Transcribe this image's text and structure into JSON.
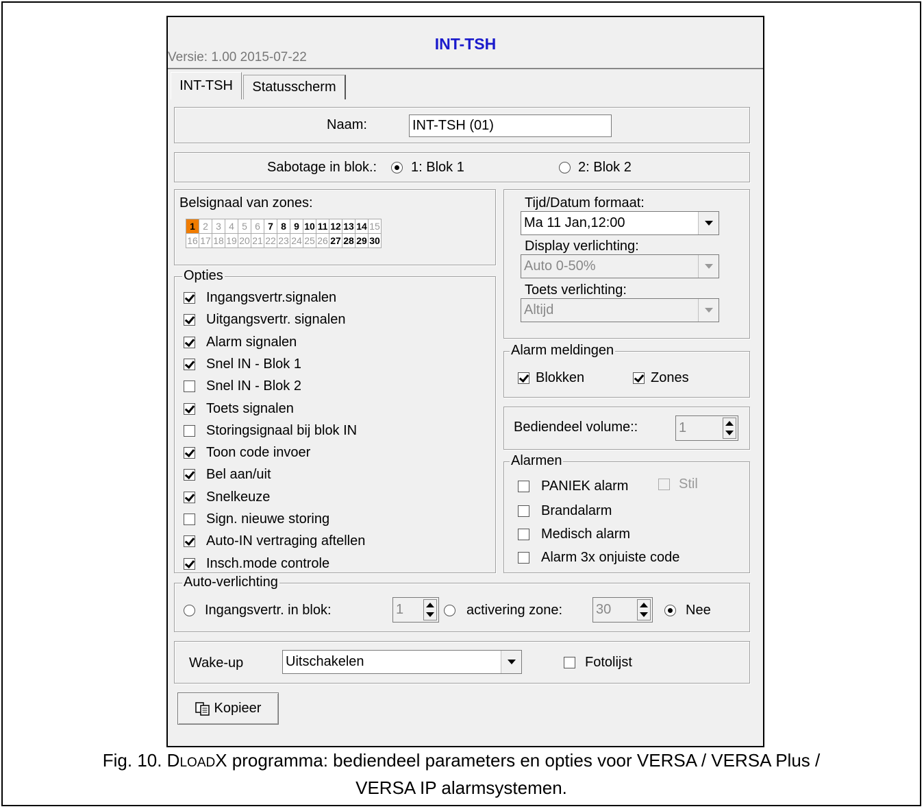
{
  "header": {
    "title": "INT-TSH",
    "version": "Versie: 1.00 2015-07-22"
  },
  "tabs": [
    {
      "label": "INT-TSH",
      "active": true
    },
    {
      "label": "Statusscherm",
      "active": false
    }
  ],
  "naam": {
    "label": "Naam:",
    "value": "INT-TSH (01)"
  },
  "sabotage": {
    "label": "Sabotage in blok.:",
    "options": [
      {
        "label": "1: Blok 1",
        "selected": true
      },
      {
        "label": "2: Blok 2",
        "selected": false
      }
    ]
  },
  "belsignaal": {
    "title": "Belsignaal van zones:",
    "zones": [
      {
        "n": "1",
        "state": "sel"
      },
      {
        "n": "2",
        "state": "off"
      },
      {
        "n": "3",
        "state": "off"
      },
      {
        "n": "4",
        "state": "off"
      },
      {
        "n": "5",
        "state": "off"
      },
      {
        "n": "6",
        "state": "off"
      },
      {
        "n": "7",
        "state": "on"
      },
      {
        "n": "8",
        "state": "on"
      },
      {
        "n": "9",
        "state": "on"
      },
      {
        "n": "10",
        "state": "on"
      },
      {
        "n": "11",
        "state": "on"
      },
      {
        "n": "12",
        "state": "on"
      },
      {
        "n": "13",
        "state": "on"
      },
      {
        "n": "14",
        "state": "on"
      },
      {
        "n": "15",
        "state": "off"
      },
      {
        "n": "16",
        "state": "off"
      },
      {
        "n": "17",
        "state": "off"
      },
      {
        "n": "18",
        "state": "off"
      },
      {
        "n": "19",
        "state": "off"
      },
      {
        "n": "20",
        "state": "off"
      },
      {
        "n": "21",
        "state": "off"
      },
      {
        "n": "22",
        "state": "off"
      },
      {
        "n": "23",
        "state": "off"
      },
      {
        "n": "24",
        "state": "off"
      },
      {
        "n": "25",
        "state": "off"
      },
      {
        "n": "26",
        "state": "off"
      },
      {
        "n": "27",
        "state": "on"
      },
      {
        "n": "28",
        "state": "on"
      },
      {
        "n": "29",
        "state": "on"
      },
      {
        "n": "30",
        "state": "on"
      }
    ]
  },
  "opties": {
    "title": "Opties",
    "items": [
      {
        "label": "Ingangsvertr.signalen",
        "checked": true
      },
      {
        "label": "Uitgangsvertr. signalen",
        "checked": true
      },
      {
        "label": "Alarm signalen",
        "checked": true
      },
      {
        "label": "Snel IN - Blok 1",
        "checked": true
      },
      {
        "label": "Snel IN - Blok 2",
        "checked": false
      },
      {
        "label": "Toets signalen",
        "checked": true
      },
      {
        "label": "Storingsignaal bij blok IN",
        "checked": false
      },
      {
        "label": "Toon code invoer",
        "checked": true
      },
      {
        "label": "Bel aan/uit",
        "checked": true
      },
      {
        "label": "Snelkeuze",
        "checked": true
      },
      {
        "label": "Sign. nieuwe storing",
        "checked": false
      },
      {
        "label": "Auto-IN vertraging aftellen",
        "checked": true
      },
      {
        "label": "Insch.mode controle",
        "checked": true
      }
    ]
  },
  "tijd": {
    "label": "Tijd/Datum formaat:",
    "value": "Ma 11 Jan,12:00",
    "display_label": "Display verlichting:",
    "display_value": "Auto 0-50%",
    "toets_label": "Toets verlichting:",
    "toets_value": "Altijd"
  },
  "alarm_meldingen": {
    "title": "Alarm meldingen",
    "blokken": "Blokken",
    "zones": "Zones"
  },
  "volume": {
    "label": "Bediendeel  volume::",
    "value": "1"
  },
  "alarmen": {
    "title": "Alarmen",
    "paniek": "PANIEK alarm",
    "stil": "Stil",
    "brand": "Brandalarm",
    "medisch": "Medisch alarm",
    "onjuist": "Alarm 3x onjuiste code"
  },
  "auto_verlichting": {
    "title": "Auto-verlichting",
    "ingang_label": "Ingangsvertr. in blok:",
    "ingang_value": "1",
    "zone_label": "activering zone:",
    "zone_value": "30",
    "nee_label": "Nee"
  },
  "wakeup": {
    "label": "Wake-up",
    "value": "Uitschakelen",
    "fotolijst": "Fotolijst"
  },
  "kopieer": {
    "label": "Kopieer"
  },
  "caption": {
    "line1_pre": "Fig. 10. D",
    "line1_sc": "LOAD",
    "line1_post": "X programma: bediendeel parameters en opties voor VERSA / VERSA Plus /",
    "line2": "VERSA IP alarmsystemen."
  }
}
